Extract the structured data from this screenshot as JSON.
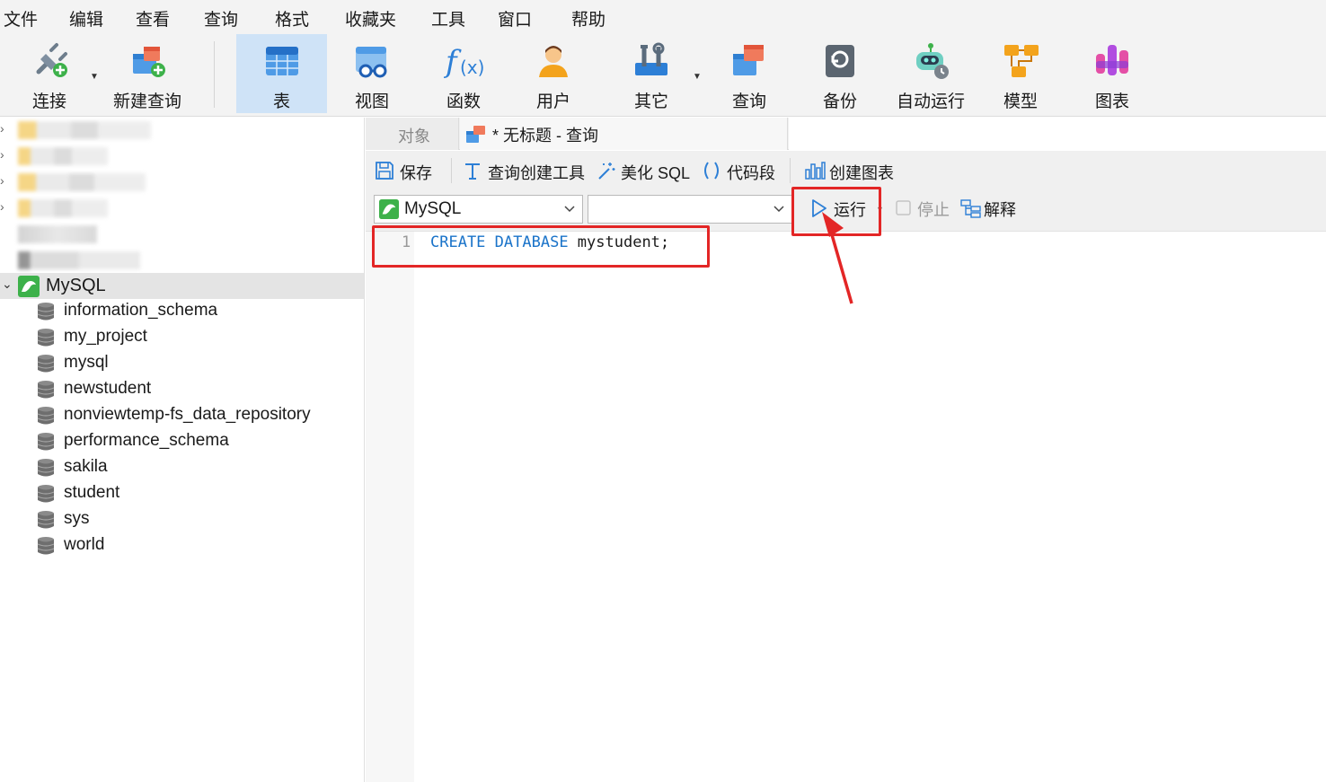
{
  "menu": [
    "文件",
    "编辑",
    "查看",
    "查询",
    "格式",
    "收藏夹",
    "工具",
    "窗口",
    "帮助"
  ],
  "toolbar": {
    "connect": "连接",
    "new_query": "新建查询",
    "table": "表",
    "view": "视图",
    "function": "函数",
    "user": "用户",
    "other": "其它",
    "query": "查询",
    "backup": "备份",
    "auto_run": "自动运行",
    "model": "模型",
    "chart": "图表"
  },
  "navigator": {
    "connection": "MySQL",
    "databases": [
      "information_schema",
      "my_project",
      "mysql",
      "newstudent",
      "nonviewtemp-fs_data_repository",
      "performance_schema",
      "sakila",
      "student",
      "sys",
      "world"
    ]
  },
  "tabs": {
    "objects": "对象",
    "query_tab": "* 无标题 - 查询"
  },
  "query_toolbar": {
    "save": "保存",
    "query_builder": "查询创建工具",
    "beautify": "美化 SQL",
    "snippet": "代码段",
    "create_chart": "创建图表"
  },
  "selectors": {
    "connection": "MySQL",
    "database": ""
  },
  "run_bar": {
    "run": "运行",
    "stop": "停止",
    "explain": "解释"
  },
  "editor": {
    "line_number": "1",
    "keyword1": "CREATE",
    "keyword2": "DATABASE",
    "rest": " mystudent;"
  },
  "colors": {
    "accent": "#1a73c9",
    "annotation": "#e32626",
    "active_tool": "#cfe3f7",
    "mysql_green": "#3db14a"
  }
}
